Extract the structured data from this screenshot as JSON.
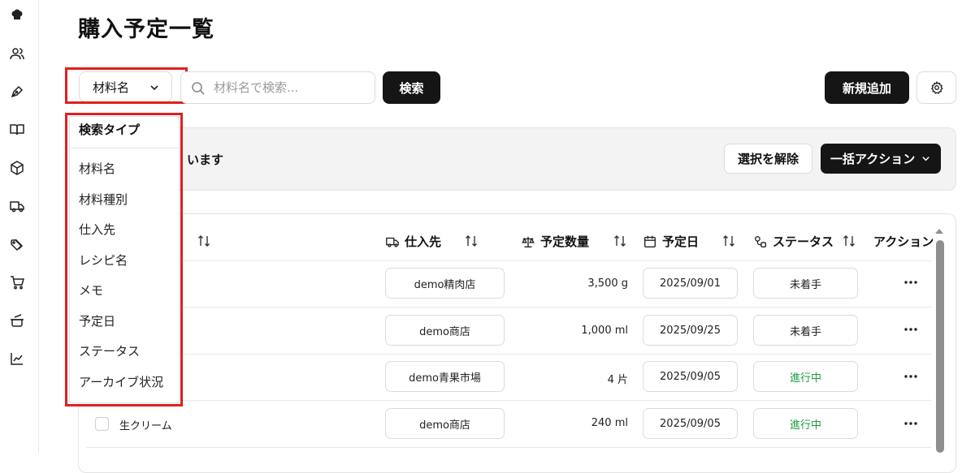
{
  "sidebar": {
    "icons": [
      "chef-hat-icon",
      "users-icon",
      "pen-icon",
      "book-icon",
      "box-icon",
      "truck-icon",
      "tags-icon",
      "cart-icon",
      "pot-icon",
      "chart-icon"
    ]
  },
  "page": {
    "title": "購入予定一覧"
  },
  "search": {
    "type_label": "材料名",
    "placeholder": "材料名で検索...",
    "search_button": "検索"
  },
  "toolbar": {
    "add_button": "新規追加"
  },
  "selection_bar": {
    "text": "います",
    "clear_button": "選択を解除",
    "bulk_action_button": "一括アクション"
  },
  "dropdown": {
    "header": "検索タイプ",
    "items": [
      "材料名",
      "材料種別",
      "仕入先",
      "レシピ名",
      "メモ",
      "予定日",
      "ステータス",
      "アーカイブ状況"
    ]
  },
  "table": {
    "headers": {
      "supplier": "仕入先",
      "quantity": "予定数量",
      "date": "予定日",
      "status": "ステータス",
      "action": "アクション"
    },
    "rows": [
      {
        "name": "",
        "supplier": "demo精肉店",
        "quantity": "3,500 g",
        "date": "2025/09/01",
        "status": "未着手",
        "status_color": "#111111"
      },
      {
        "name": "",
        "supplier": "demo商店",
        "quantity": "1,000 ml",
        "date": "2025/09/25",
        "status": "未着手",
        "status_color": "#111111"
      },
      {
        "name": "",
        "supplier": "demo青果市場",
        "quantity": "4 片",
        "date": "2025/09/05",
        "status": "進行中",
        "status_color": "#1e9b3e"
      },
      {
        "name": "生クリーム",
        "supplier": "demo商店",
        "quantity": "240 ml",
        "date": "2025/09/05",
        "status": "進行中",
        "status_color": "#1e9b3e"
      }
    ]
  },
  "colors": {
    "highlight": "#e01f1f",
    "primary_button": "#151515",
    "in_progress": "#1e9b3e"
  }
}
